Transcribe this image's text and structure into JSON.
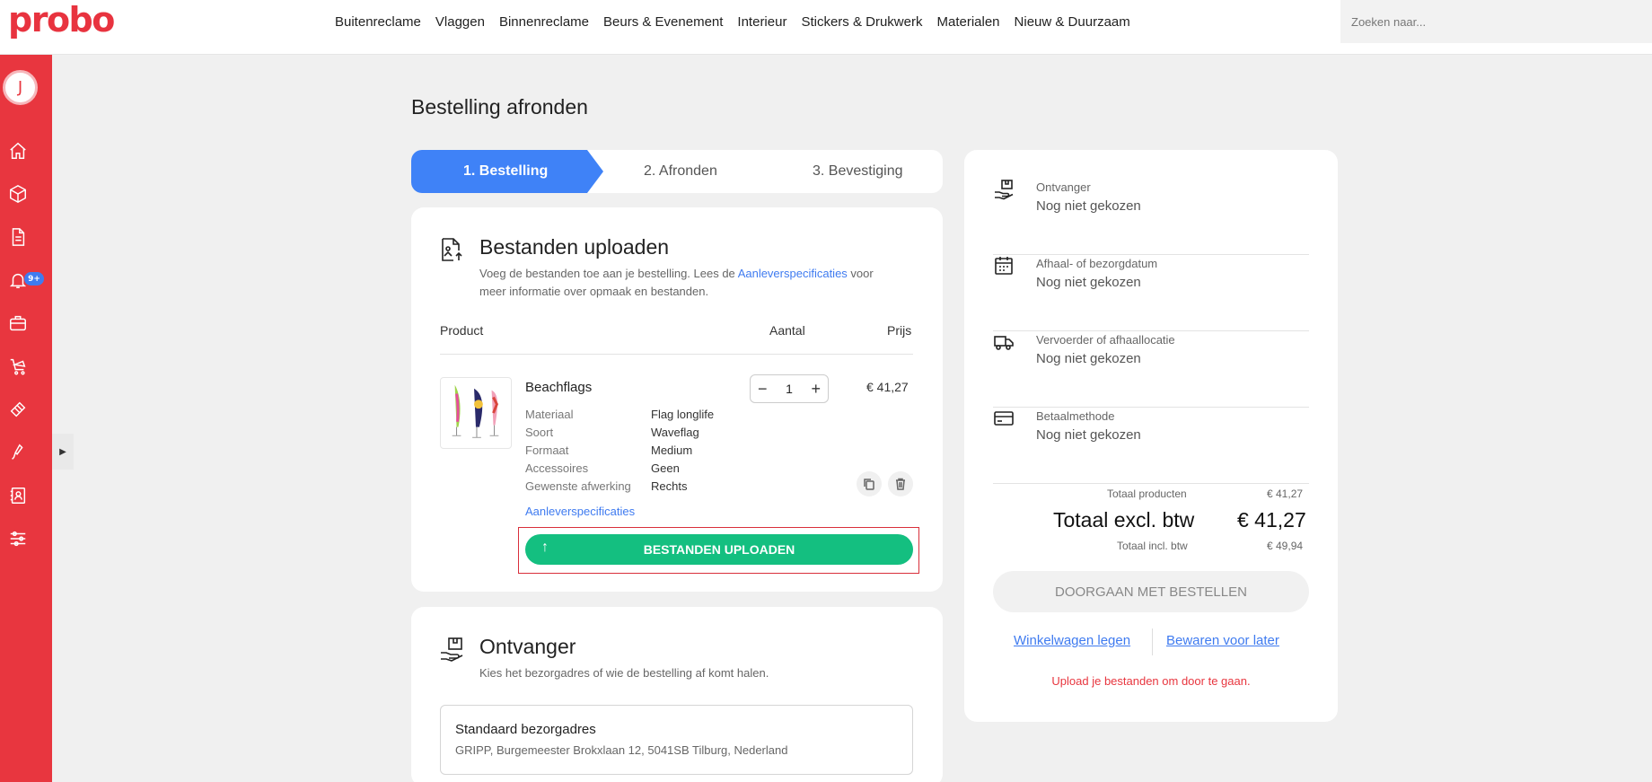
{
  "header": {
    "logo": "probo",
    "nav": [
      "Buitenreclame",
      "Vlaggen",
      "Binnenreclame",
      "Beurs & Evenement",
      "Interieur",
      "Stickers & Drukwerk",
      "Materialen",
      "Nieuw & Duurzaam"
    ],
    "search_placeholder": "Zoeken naar..."
  },
  "sidebar": {
    "avatar_initial": "J",
    "notification_badge": "9+",
    "icons": [
      "home-icon",
      "box-icon",
      "document-icon",
      "bell-icon",
      "briefcase-icon",
      "cart-icon",
      "tape-icon",
      "brush-icon",
      "address-book-icon",
      "sliders-icon"
    ]
  },
  "page": {
    "title": "Bestelling afronden"
  },
  "steps": {
    "step1": "1. Bestelling",
    "step2": "2. Afronden",
    "step3": "3. Bevestiging"
  },
  "upload_card": {
    "title": "Bestanden uploaden",
    "subtitle_before": "Voeg de bestanden toe aan je bestelling. Lees de ",
    "subtitle_link": "Aanleverspecificaties",
    "subtitle_after": " voor",
    "subtitle_line2": "meer informatie over opmaak en bestanden.",
    "col_product": "Product",
    "col_qty": "Aantal",
    "col_price": "Prijs",
    "product": {
      "name": "Beachflags",
      "specs": [
        {
          "key": "Materiaal",
          "value": "Flag longlife"
        },
        {
          "key": "Soort",
          "value": "Waveflag"
        },
        {
          "key": "Formaat",
          "value": "Medium"
        },
        {
          "key": "Accessoires",
          "value": "Geen"
        },
        {
          "key": "Gewenste afwerking",
          "value": "Rechts"
        }
      ],
      "quantity": "1",
      "price": "€ 41,27",
      "spec_link": "Aanleverspecificaties"
    },
    "upload_button": "BESTANDEN UPLOADEN"
  },
  "recipient_card": {
    "title": "Ontvanger",
    "subtitle": "Kies het bezorgadres of wie de bestelling af komt halen.",
    "address_title": "Standaard bezorgadres",
    "address_line": "GRIPP, Burgemeester Brokxlaan 12, 5041SB Tilburg, Nederland"
  },
  "summary": {
    "rows": [
      {
        "label": "Ontvanger",
        "value": "Nog niet gekozen",
        "icon": "recipient-icon"
      },
      {
        "label": "Afhaal- of bezorgdatum",
        "value": "Nog niet gekozen",
        "icon": "calendar-icon"
      },
      {
        "label": "Vervoerder of afhaallocatie",
        "value": "Nog niet gekozen",
        "icon": "truck-icon"
      },
      {
        "label": "Betaalmethode",
        "value": "Nog niet gekozen",
        "icon": "credit-card-icon"
      }
    ],
    "total_products_label": "Totaal producten",
    "total_products_value": "€ 41,27",
    "total_excl_label": "Totaal excl. btw",
    "total_excl_value": "€ 41,27",
    "total_incl_label": "Totaal incl. btw",
    "total_incl_value": "€ 49,94",
    "continue_button": "DOORGAAN MET BESTELLEN",
    "clear_cart_link": "Winkelwagen legen",
    "save_later_link": "Bewaren voor later",
    "warning": "Upload je bestanden om door te gaan."
  },
  "colors": {
    "brand_red": "#e8363f",
    "accent_blue": "#3f82f7",
    "upload_green": "#14bf80"
  }
}
